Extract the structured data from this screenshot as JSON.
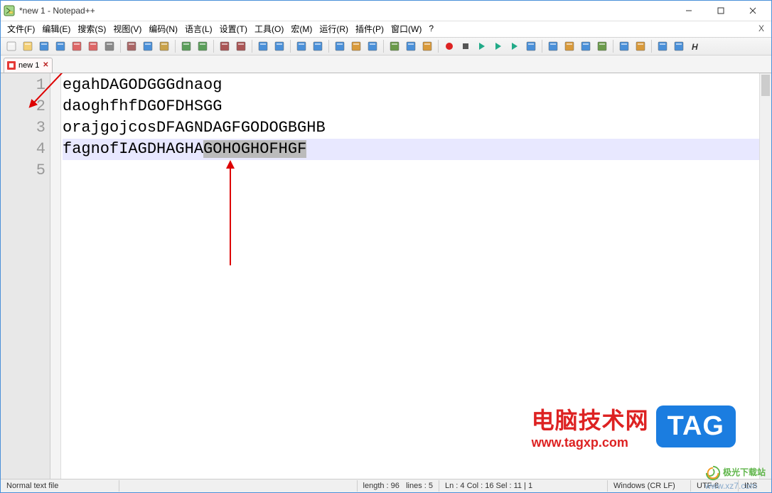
{
  "window": {
    "title": "*new 1 - Notepad++"
  },
  "menu": {
    "items": [
      {
        "label": "文件(F)"
      },
      {
        "label": "编辑(E)"
      },
      {
        "label": "搜索(S)"
      },
      {
        "label": "视图(V)"
      },
      {
        "label": "编码(N)"
      },
      {
        "label": "语言(L)"
      },
      {
        "label": "设置(T)"
      },
      {
        "label": "工具(O)"
      },
      {
        "label": "宏(M)"
      },
      {
        "label": "运行(R)"
      },
      {
        "label": "插件(P)"
      },
      {
        "label": "窗口(W)"
      },
      {
        "label": "?"
      }
    ],
    "close_x": "X"
  },
  "toolbar_icons": [
    "new",
    "open",
    "save",
    "save-all",
    "close",
    "close-all",
    "print",
    "|",
    "cut",
    "copy",
    "paste",
    "|",
    "undo",
    "redo",
    "|",
    "find",
    "replace",
    "|",
    "zoom-in",
    "zoom-out",
    "|",
    "sync-v",
    "sync-h",
    "|",
    "wrap",
    "all-chars",
    "indent",
    "|",
    "lang",
    "eol",
    "monitor",
    "|",
    "record",
    "stop",
    "play",
    "play-multi",
    "fast-forward",
    "next",
    "|",
    "toggle-1",
    "toggle-2",
    "toggle-3",
    "toggle-4",
    "|",
    "collapse",
    "expand",
    "|",
    "hide",
    "show",
    "bold"
  ],
  "tabs": [
    {
      "label": "new 1",
      "dirty": true
    }
  ],
  "gutter_lines": [
    "1",
    "2",
    "3",
    "4",
    "5"
  ],
  "editor_lines": [
    {
      "text": "egahDAGODGGGdnaog",
      "hl": false,
      "sel": null
    },
    {
      "text": "daoghfhfDGOFDHSGG",
      "hl": false,
      "sel": null
    },
    {
      "text": "orajgojcosDFAGNDAGFGODOGBGHB",
      "hl": false,
      "sel": null
    },
    {
      "text_before": "fagnofIAGDHAGHA",
      "text_sel": "GOHOGHOFHGF",
      "text_after": "",
      "hl": true,
      "sel": true
    }
  ],
  "caret": {
    "line": 4,
    "col": 16
  },
  "status": {
    "lang": "Normal text file",
    "length_label": "length : 96",
    "lines_label": "lines : 5",
    "pos_label": "Ln : 4    Col : 16    Sel : 11 | 1",
    "eol": "Windows (CR LF)",
    "encoding": "UTF-8",
    "ovr": "INS"
  },
  "watermark1": {
    "cn": "电脑技术网",
    "url": "www.tagxp.com",
    "tag": "TAG"
  },
  "watermark2": {
    "name": "极光下载站",
    "url": "www.xz7.com"
  }
}
